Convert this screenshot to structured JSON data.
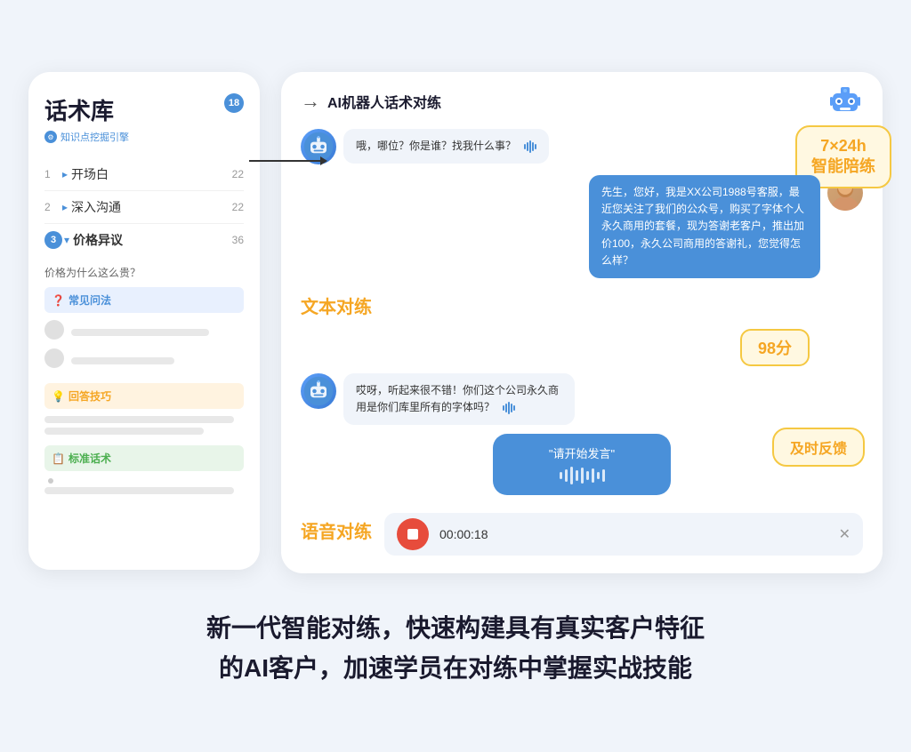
{
  "left_panel": {
    "title": "话术库",
    "subtitle": "知识点挖掘引擎",
    "badge": "18",
    "menu_items": [
      {
        "num": "1",
        "label": "开场白",
        "count": "22",
        "active": false
      },
      {
        "num": "2",
        "label": "深入沟通",
        "count": "22",
        "active": false
      },
      {
        "num": "3",
        "label": "价格异议",
        "count": "36",
        "active": true
      }
    ],
    "question": "价格为什么这么贵？",
    "sections": [
      {
        "label": "常见问法",
        "color": "blue",
        "icon": "❓"
      },
      {
        "label": "回答技巧",
        "color": "orange",
        "icon": "💡"
      },
      {
        "label": "标准话术",
        "color": "green",
        "icon": "📋"
      }
    ]
  },
  "right_panel": {
    "title": "AI机器人话术对练",
    "messages": [
      {
        "role": "robot",
        "text": "哦，哪位？你是谁？找我什么事？",
        "has_sound": true
      },
      {
        "role": "user",
        "text": "先生，您好，我是XX公司1988号客服，最近您关注了我们的公众号，购买了字体个人永久商用的套餐，现为答谢老客户，推出加价100，永久公司商用的答谢礼，您觉得怎么样？"
      },
      {
        "role": "robot",
        "text": "哎呀，听起来很不错！你们这个公司永久商用是你们库里所有的字体吗？",
        "has_sound": true
      }
    ],
    "text_drill_label": "文本对练",
    "voice_drill_label": "语音对练",
    "score": "98分",
    "feedback_label": "及时反馈",
    "badge_724": "7×24h\n智能陪练",
    "speaking_text": "\"请开始发言\"",
    "timer": "00:00:18",
    "score_num": "98分"
  },
  "bottom": {
    "line1": "新一代智能对练，快速构建具有真实客户特征",
    "line2": "的AI客户，加速学员在对练中掌握实战技能"
  },
  "arrow_label": "→"
}
